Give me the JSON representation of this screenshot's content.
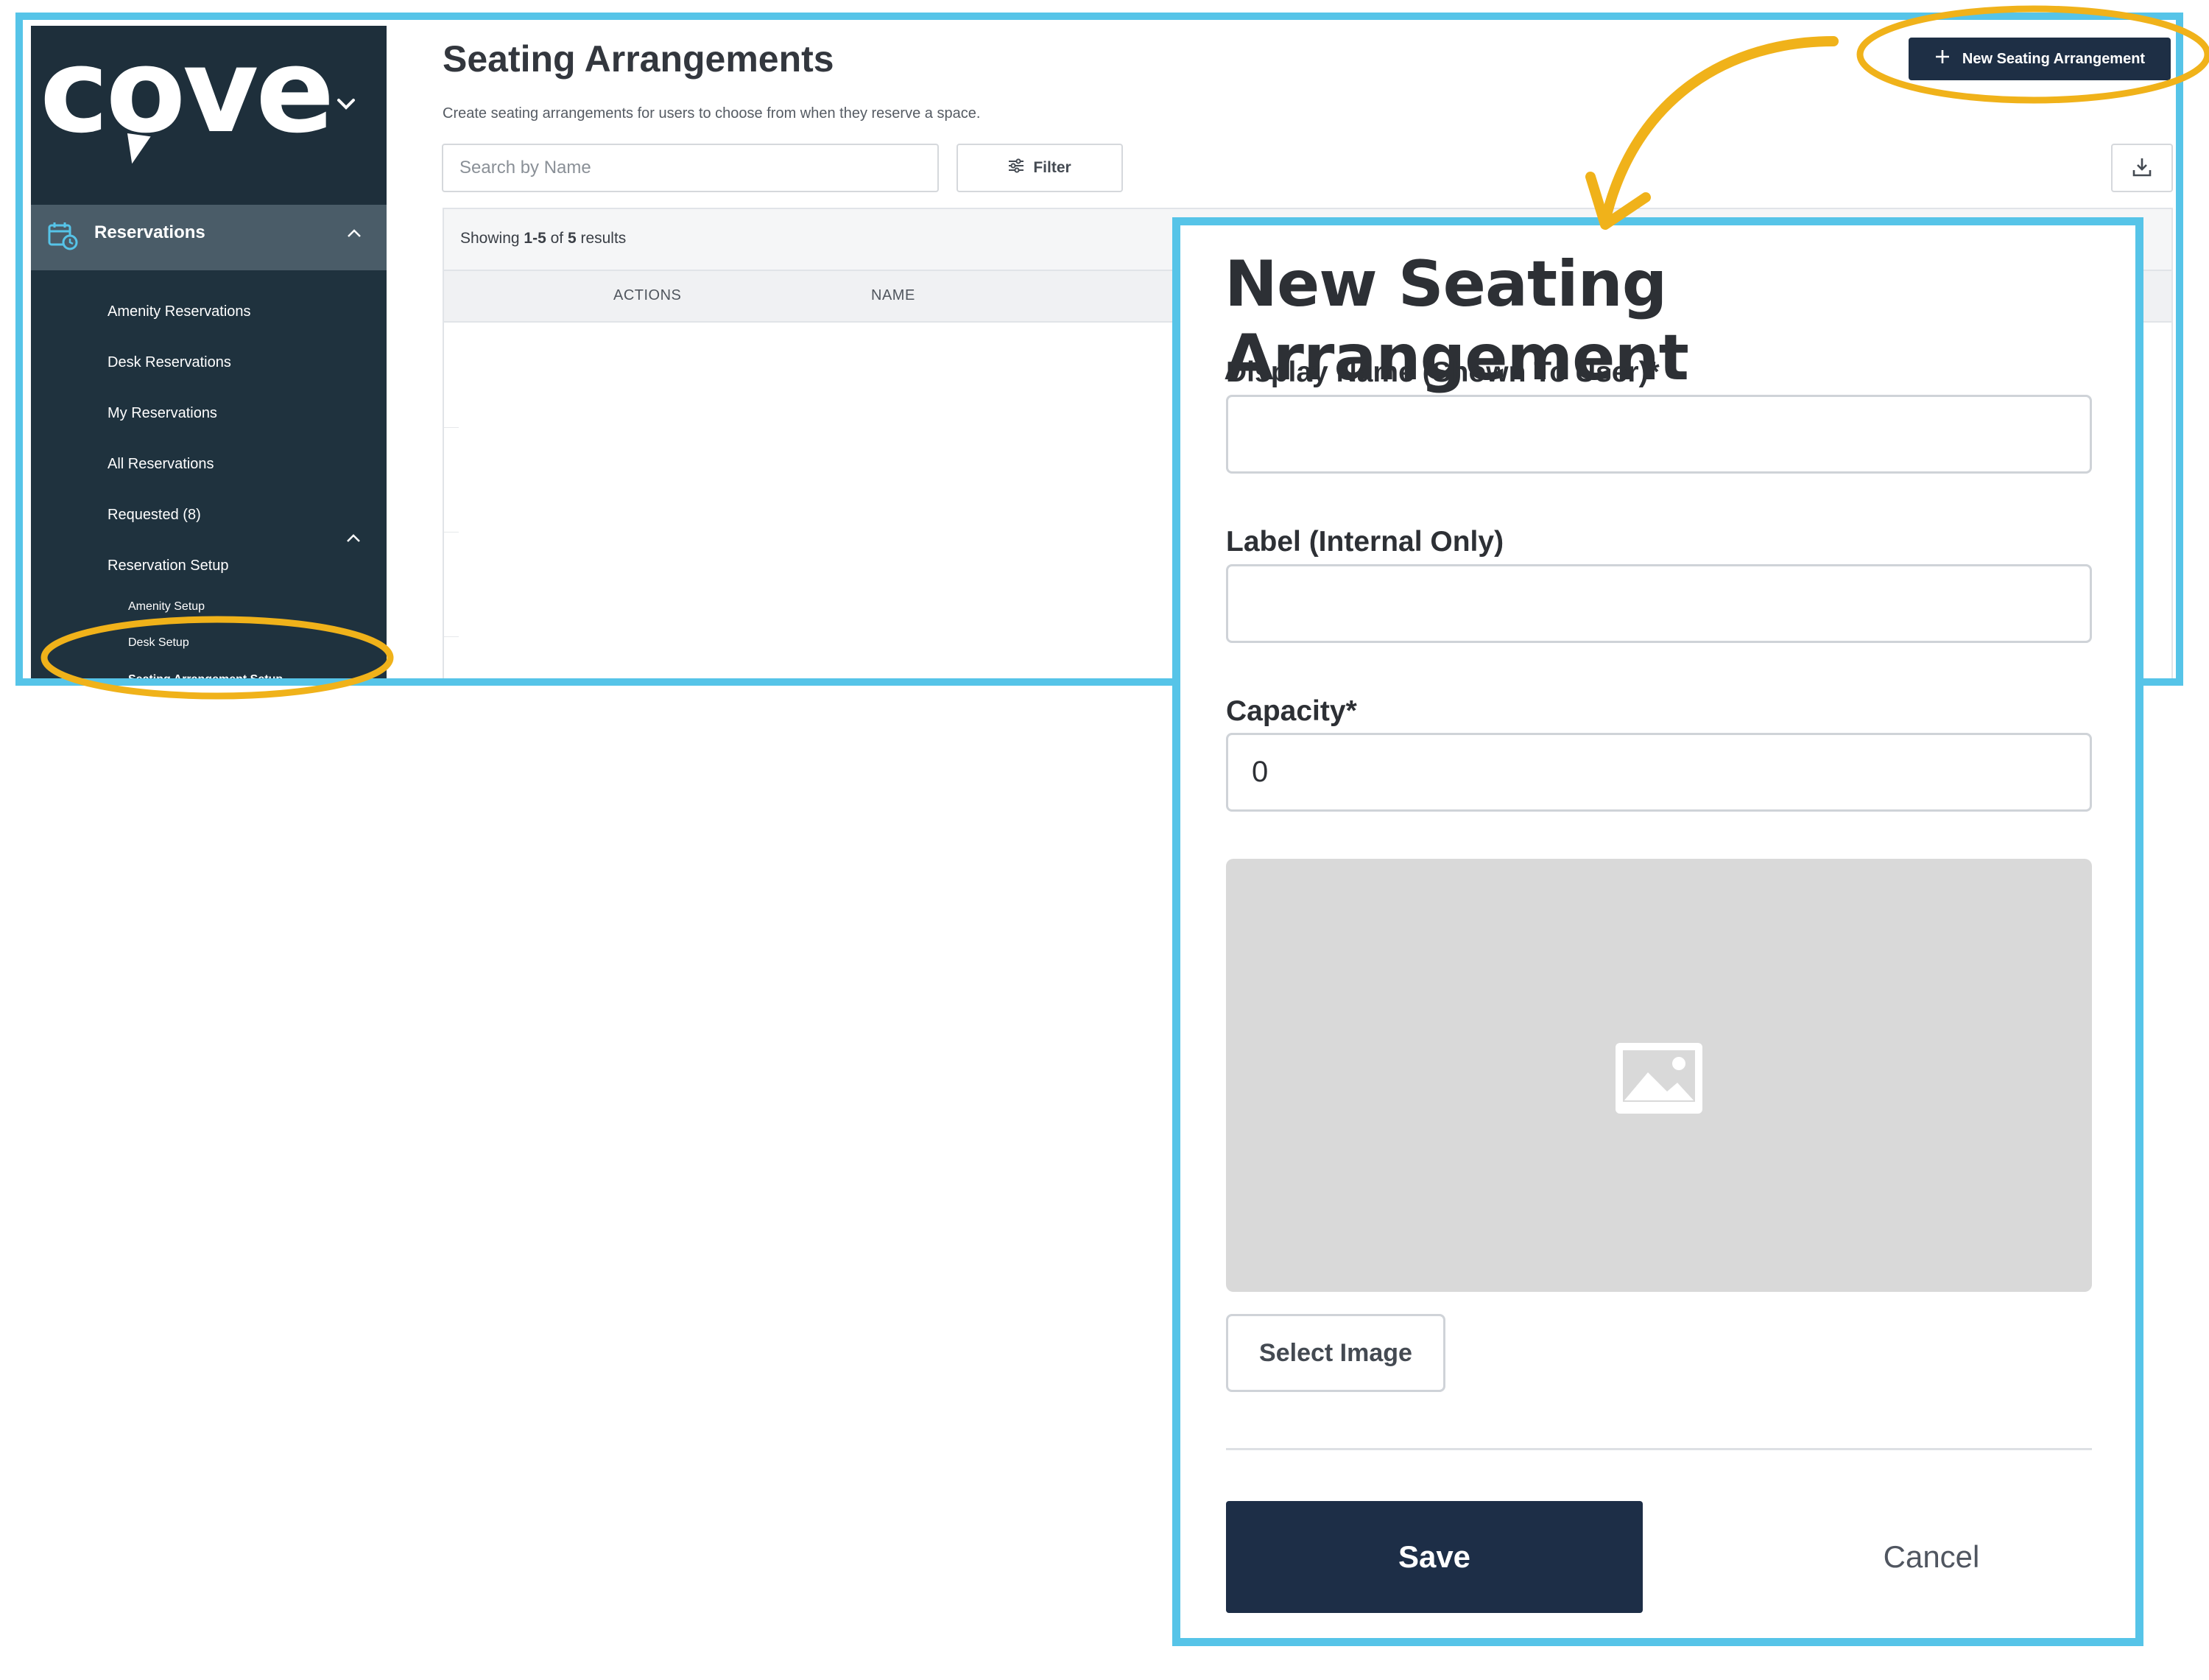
{
  "sidebar": {
    "logo": "cove",
    "section_label": "Reservations",
    "items": [
      {
        "label": "Amenity Reservations"
      },
      {
        "label": "Desk Reservations"
      },
      {
        "label": "My Reservations"
      },
      {
        "label": "All Reservations"
      },
      {
        "label": "Requested (8)"
      },
      {
        "label": "Reservation Setup"
      }
    ],
    "sub_items": [
      {
        "label": "Amenity Setup"
      },
      {
        "label": "Desk Setup"
      },
      {
        "label": "Seating Arrangement Setup",
        "active": true
      }
    ],
    "icons": {
      "section": "calendar-clock-icon",
      "brand_menu": "chevron-down-icon",
      "collapse": "caret-up-icon"
    }
  },
  "header": {
    "title": "Seating Arrangements",
    "subtitle": "Create seating arrangements for users to choose from when they reserve a space.",
    "new_button_label": "New Seating Arrangement"
  },
  "search": {
    "placeholder": "Search by Name"
  },
  "filter": {
    "label": "Filter"
  },
  "table": {
    "showing_prefix": "Showing ",
    "range": "1-5",
    "of": " of ",
    "total": "5",
    "suffix": " results",
    "columns": [
      "ACTIONS",
      "NAME"
    ]
  },
  "modal": {
    "title": "New Seating Arrangement",
    "display_name_label": "Display Name (Shown To User)*",
    "display_name_value": "",
    "label_label": "Label (Internal Only)",
    "label_value": "",
    "capacity_label": "Capacity*",
    "capacity_value": "0",
    "select_image_label": "Select Image",
    "save_label": "Save",
    "cancel_label": "Cancel"
  },
  "colors": {
    "frame_border": "#56c4e8",
    "annotation": "#f0b21a",
    "sidebar_bg": "#1f323e",
    "primary_button": "#1e2f45"
  }
}
